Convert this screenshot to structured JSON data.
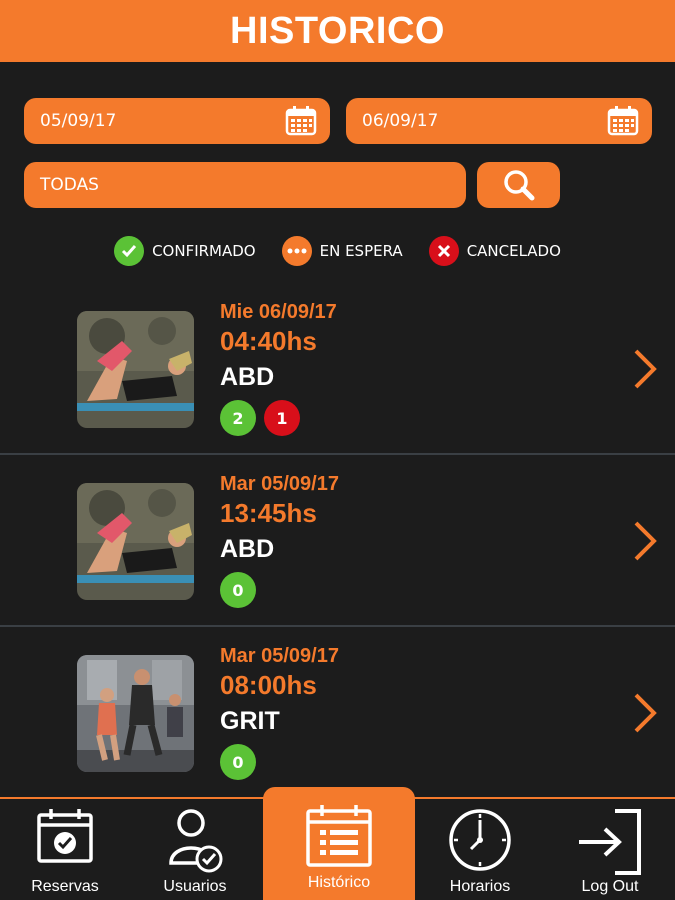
{
  "header": {
    "title": "HISTORICO"
  },
  "filters": {
    "date_from": "05/09/17",
    "date_to": "06/09/17",
    "category": "TODAS"
  },
  "legend": [
    {
      "label": "CONFIRMADO",
      "color": "#5bc236",
      "icon": "check-icon"
    },
    {
      "label": "EN ESPERA",
      "color": "#f47a2c",
      "icon": "dots-icon"
    },
    {
      "label": "CANCELADO",
      "color": "#d80f1a",
      "icon": "x-icon"
    }
  ],
  "entries": [
    {
      "date": "Mie 06/09/17",
      "time": "04:40hs",
      "class": "ABD",
      "confirmed": "2",
      "cancelled": "1",
      "image": "abs-workout-photo"
    },
    {
      "date": "Mar 05/09/17",
      "time": "13:45hs",
      "class": "ABD",
      "confirmed": "0",
      "image": "abs-workout-photo"
    },
    {
      "date": "Mar 05/09/17",
      "time": "08:00hs",
      "class": "GRIT",
      "confirmed": "0",
      "image": "group-training-photo"
    }
  ],
  "tabs": [
    {
      "label": "Reservas",
      "icon": "calendar-check-icon"
    },
    {
      "label": "Usuarios",
      "icon": "user-check-icon"
    },
    {
      "label": "Histórico",
      "icon": "list-calendar-icon",
      "active": true
    },
    {
      "label": "Horarios",
      "icon": "clock-icon"
    },
    {
      "label": "Log Out",
      "icon": "logout-icon"
    }
  ],
  "colors": {
    "accent": "#f47a2c",
    "background": "#1c1c1c",
    "confirmed": "#5bc236",
    "cancelled": "#d80f1a"
  }
}
